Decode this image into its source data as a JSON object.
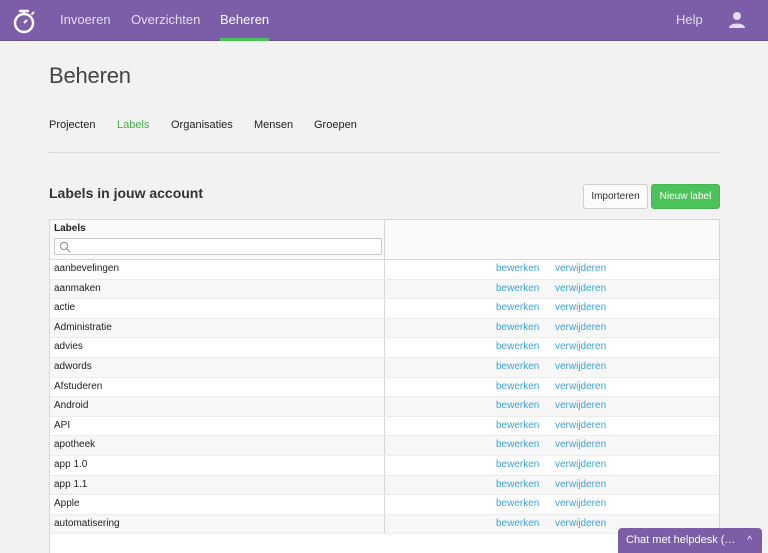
{
  "topbar": {
    "nav": [
      "Invoeren",
      "Overzichten",
      "Beheren"
    ],
    "active": "Beheren",
    "help": "Help",
    "colors": {
      "bar": "#7b5ea7",
      "accent": "#4cc35a"
    }
  },
  "page": {
    "title": "Beheren"
  },
  "subtabs": [
    "Projecten",
    "Labels",
    "Organisaties",
    "Mensen",
    "Groepen"
  ],
  "subtab_active": "Labels",
  "section": {
    "title": "Labels in jouw account"
  },
  "buttons": {
    "import": "Importeren",
    "new_label": "Nieuw label"
  },
  "table": {
    "header": "Labels",
    "search_placeholder": "",
    "rows": [
      {
        "name": "aanbevelingen",
        "edit": "bewerken",
        "delete": "verwijderen"
      },
      {
        "name": "aanmaken",
        "edit": "bewerken",
        "delete": "verwijderen"
      },
      {
        "name": "actie",
        "edit": "bewerken",
        "delete": "verwijderen"
      },
      {
        "name": "Administratie",
        "edit": "bewerken",
        "delete": "verwijderen"
      },
      {
        "name": "advies",
        "edit": "bewerken",
        "delete": "verwijderen"
      },
      {
        "name": "adwords",
        "edit": "bewerken",
        "delete": "verwijderen"
      },
      {
        "name": "Afstuderen",
        "edit": "bewerken",
        "delete": "verwijderen"
      },
      {
        "name": "Android",
        "edit": "bewerken",
        "delete": "verwijderen"
      },
      {
        "name": "API",
        "edit": "bewerken",
        "delete": "verwijderen"
      },
      {
        "name": "apotheek",
        "edit": "bewerken",
        "delete": "verwijderen"
      },
      {
        "name": "app 1.0",
        "edit": "bewerken",
        "delete": "verwijderen"
      },
      {
        "name": "app 1.1",
        "edit": "bewerken",
        "delete": "verwijderen"
      },
      {
        "name": "Apple",
        "edit": "bewerken",
        "delete": "verwijderen"
      },
      {
        "name": "automatisering",
        "edit": "bewerken",
        "delete": "verwijderen"
      }
    ]
  },
  "chat": {
    "label": "Chat met helpdesk (…",
    "chevron": "^"
  }
}
